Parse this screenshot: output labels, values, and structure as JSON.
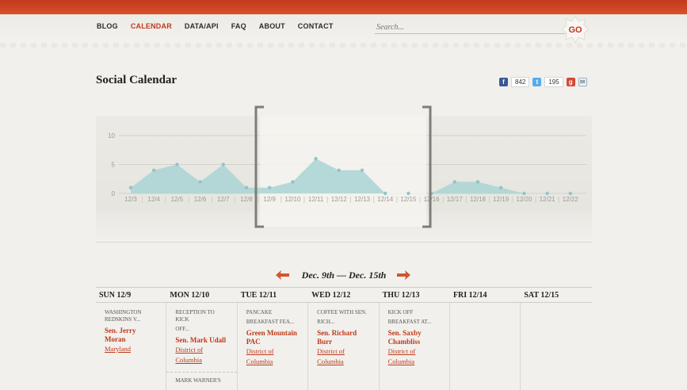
{
  "nav": {
    "items": [
      "BLOG",
      "CALENDAR",
      "DATA/API",
      "FAQ",
      "ABOUT",
      "CONTACT"
    ],
    "active": "CALENDAR"
  },
  "search": {
    "placeholder": "Search...",
    "go_label": "GO"
  },
  "page": {
    "title": "Social Calendar"
  },
  "share": {
    "facebook_count": "842",
    "twitter_count": "195",
    "icons": [
      "facebook-icon",
      "twitter-icon",
      "google-plus-icon",
      "email-icon"
    ]
  },
  "colors": {
    "accent": "#c0391b",
    "chart_fill": "#a9d3d4",
    "chart_line": "#8fc5c7",
    "header": "#cf4524"
  },
  "chart_data": {
    "type": "area",
    "categories": [
      "12/3",
      "12/4",
      "12/5",
      "12/6",
      "12/7",
      "12/8",
      "12/9",
      "12/10",
      "12/11",
      "12/12",
      "12/13",
      "12/14",
      "12/15",
      "12/16",
      "12/17",
      "12/18",
      "12/19",
      "12/20",
      "12/21",
      "12/22"
    ],
    "values": [
      1,
      4,
      5,
      2,
      5,
      1,
      1,
      2,
      6,
      4,
      4,
      0,
      0,
      0,
      2,
      2,
      1,
      0,
      0,
      0
    ],
    "yticks": [
      0,
      5,
      10
    ],
    "ylim": [
      0,
      10
    ],
    "selection": [
      "12/9",
      "12/15"
    ],
    "grid": true
  },
  "week": {
    "label": "Dec. 9th — Dec. 15th"
  },
  "calendar": {
    "days": [
      "SUN 12/9",
      "MON 12/10",
      "TUE 12/11",
      "WED 12/12",
      "THU 12/13",
      "FRI 12/14",
      "SAT 12/15"
    ],
    "events": [
      [
        {
          "title": "WASHINGTON",
          "sub": "REDSKINS V...",
          "name": "Sen. Jerry Moran",
          "links": [
            "Maryland"
          ]
        }
      ],
      [
        {
          "title": "RECEPTION TO KICK",
          "sub": "OFF...",
          "name": "Sen. Mark Udall",
          "links": [
            "District of",
            "Columbia"
          ]
        },
        {
          "title": "MARK WARNER'S"
        }
      ],
      [
        {
          "title": "PANCAKE",
          "sub": "BREAKFAST FEA...",
          "name": "Green Mountain PAC",
          "links": [
            "District of",
            "Columbia"
          ]
        }
      ],
      [
        {
          "title": "COFFEE WITH SEN.",
          "sub": "RICH...",
          "name": "Sen. Richard Burr",
          "links": [
            "District of",
            "Columbia"
          ]
        }
      ],
      [
        {
          "title": "KICK OFF",
          "sub": "BREAKFAST AT...",
          "name": "Sen. Saxby Chambliss",
          "links": [
            "District of",
            "Columbia"
          ]
        }
      ],
      [],
      []
    ]
  }
}
